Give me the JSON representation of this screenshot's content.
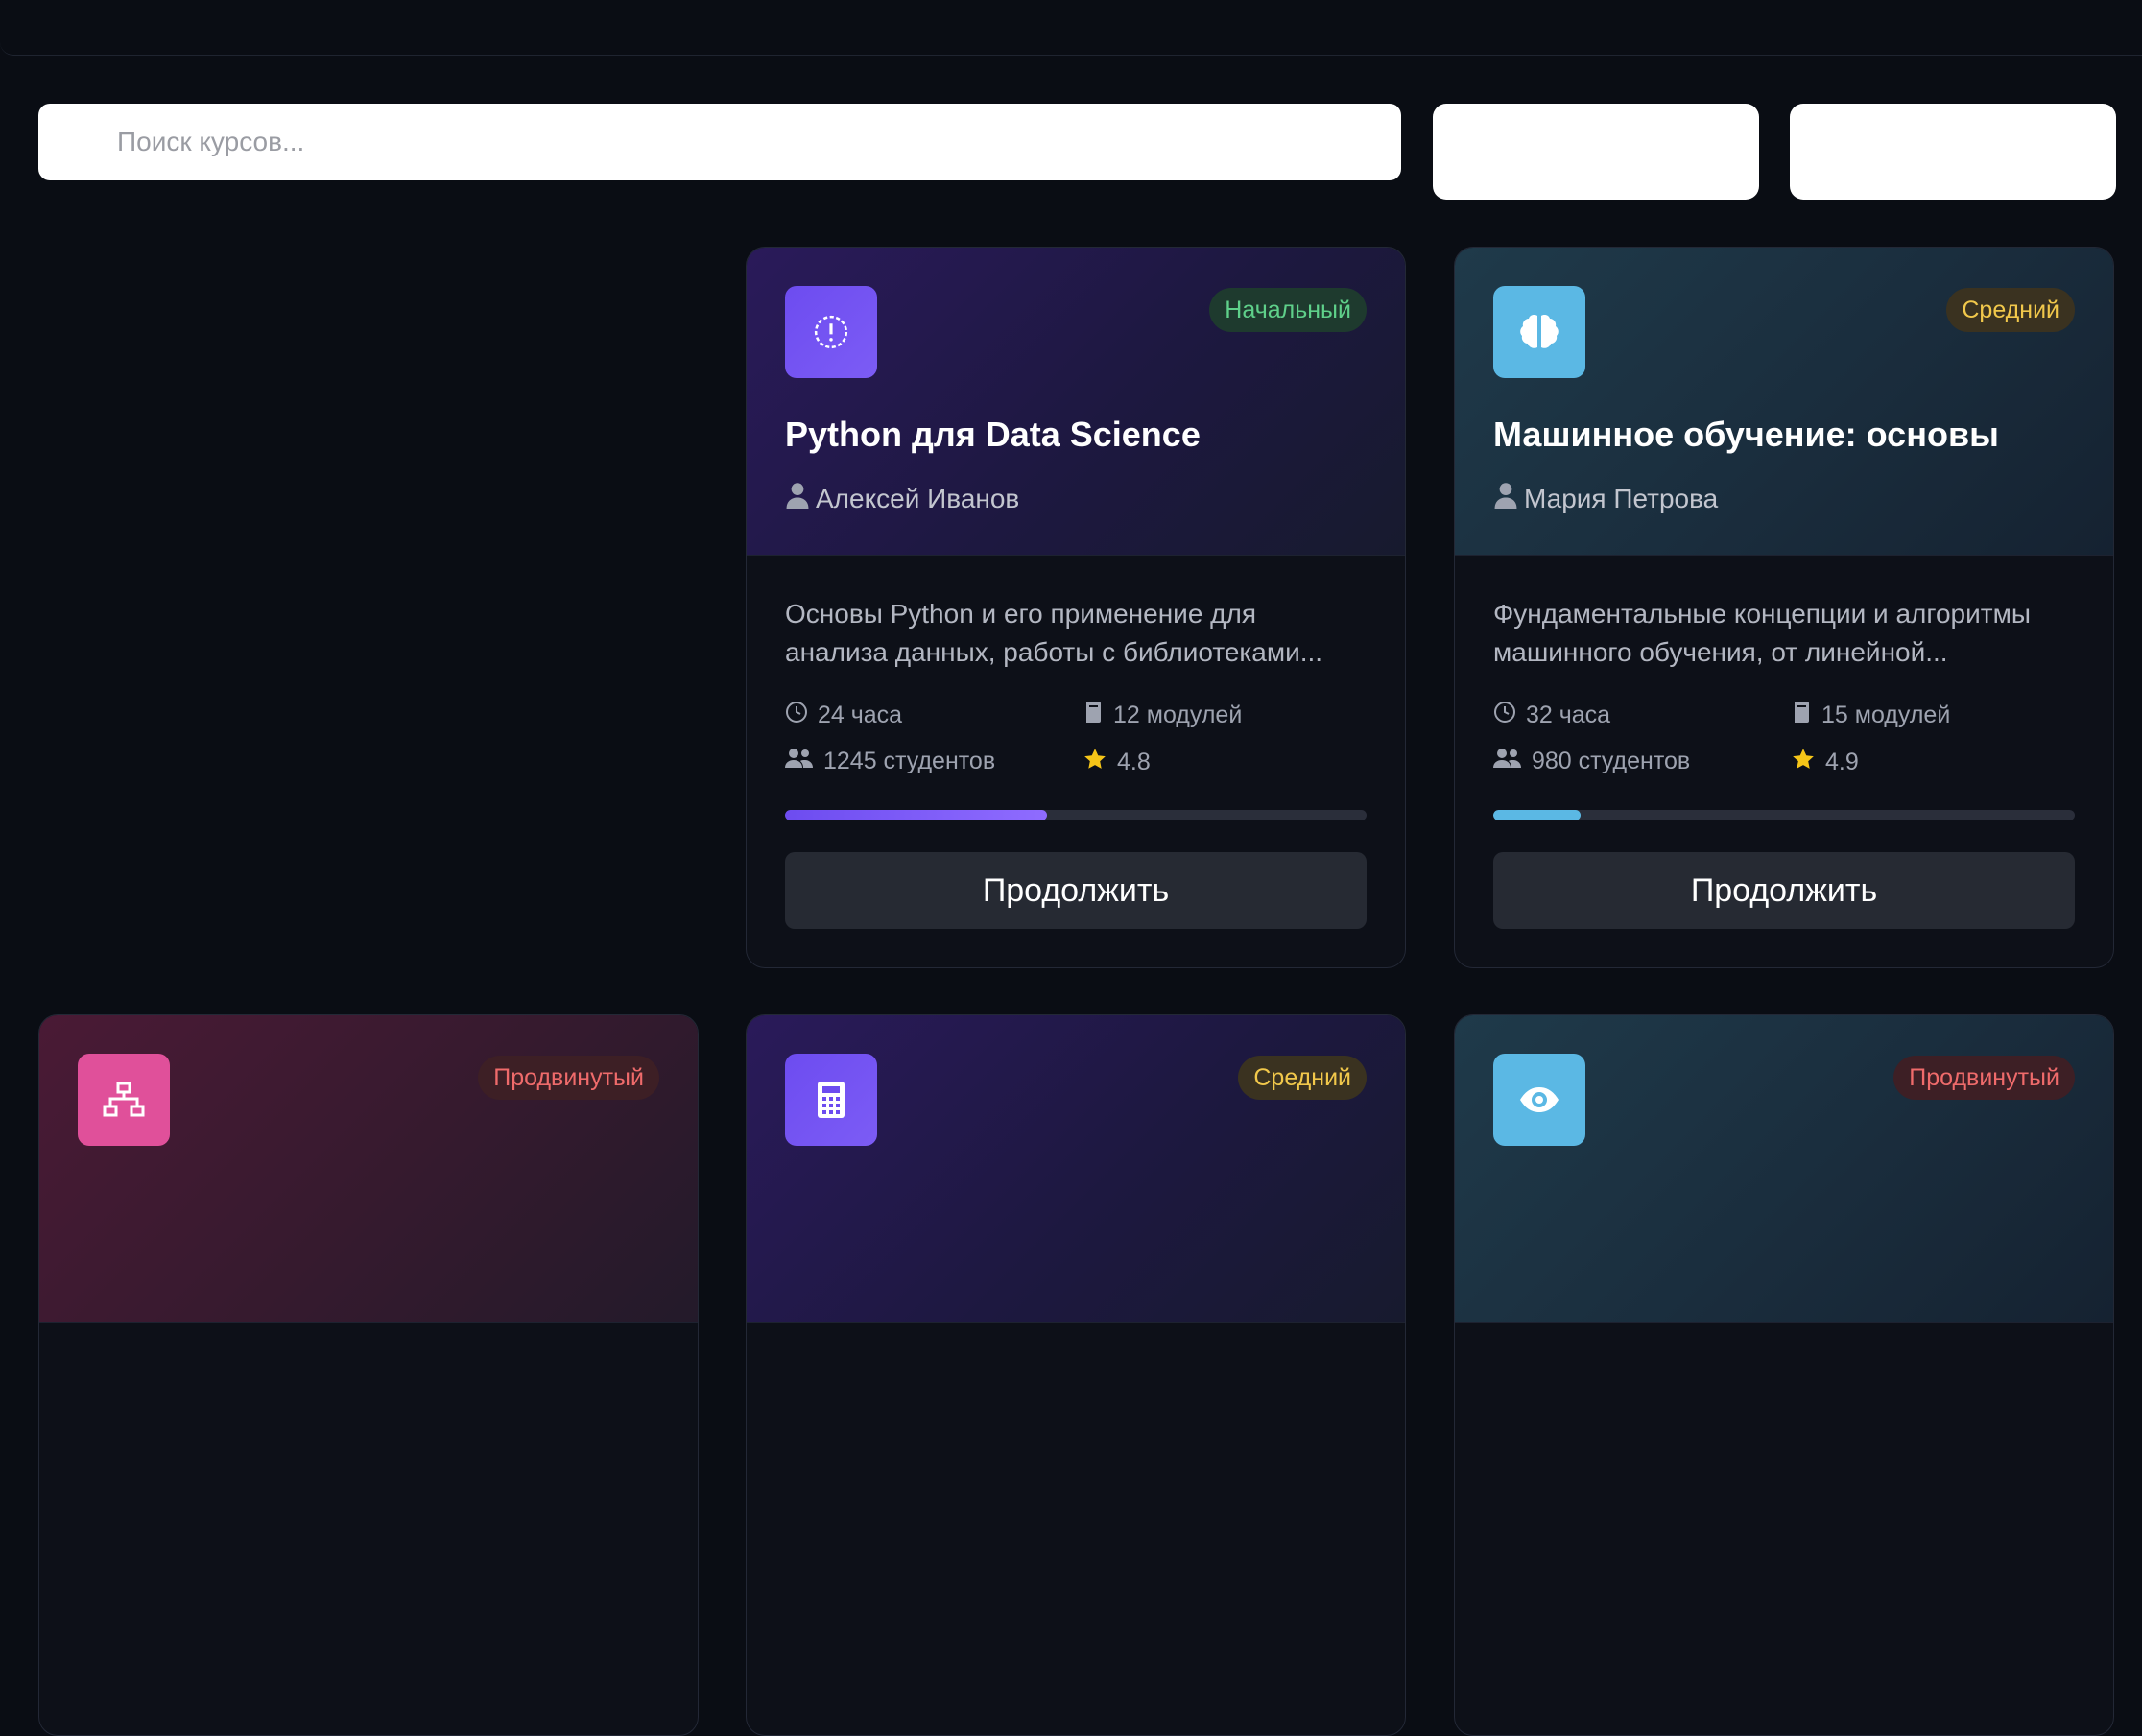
{
  "search": {
    "placeholder": "Поиск курсов..."
  },
  "courses": [
    {
      "level": "Начальный",
      "title": "Python для Data Science",
      "author": "Алексей Иванов",
      "description_line1": "Основы Python и его применение для",
      "description_line2": "анализа данных, работы с библиотеками...",
      "duration": "24 часа",
      "modules": "12 модулей",
      "students": "1245 студентов",
      "rating": "4.8",
      "progress_percent": 45,
      "button": "Продолжить",
      "icon": "alert-circle-icon"
    },
    {
      "level": "Средний",
      "title": "Машинное обучение: основы",
      "author": "Мария Петрова",
      "description_line1": "Фундаментальные концепции и алгоритмы",
      "description_line2": "машинного обучения, от линейной...",
      "duration": "32 часа",
      "modules": "15 модулей",
      "students": "980 студентов",
      "rating": "4.9",
      "progress_percent": 15,
      "button": "Продолжить",
      "icon": "brain-icon"
    },
    {
      "level": "Продвинутый",
      "icon": "network-icon"
    },
    {
      "level": "Средний",
      "icon": "calculator-icon"
    },
    {
      "level": "Продвинутый",
      "icon": "eye-icon"
    }
  ],
  "colors": {
    "background": "#0a0d14",
    "accent_purple": "#6d4cf0",
    "accent_blue": "#5bb8e4",
    "accent_pink": "#e0509a",
    "level_beginner": "#5fd08a",
    "level_intermediate": "#f1c84b",
    "level_advanced": "#ef6b6b",
    "star": "#f5c518"
  }
}
